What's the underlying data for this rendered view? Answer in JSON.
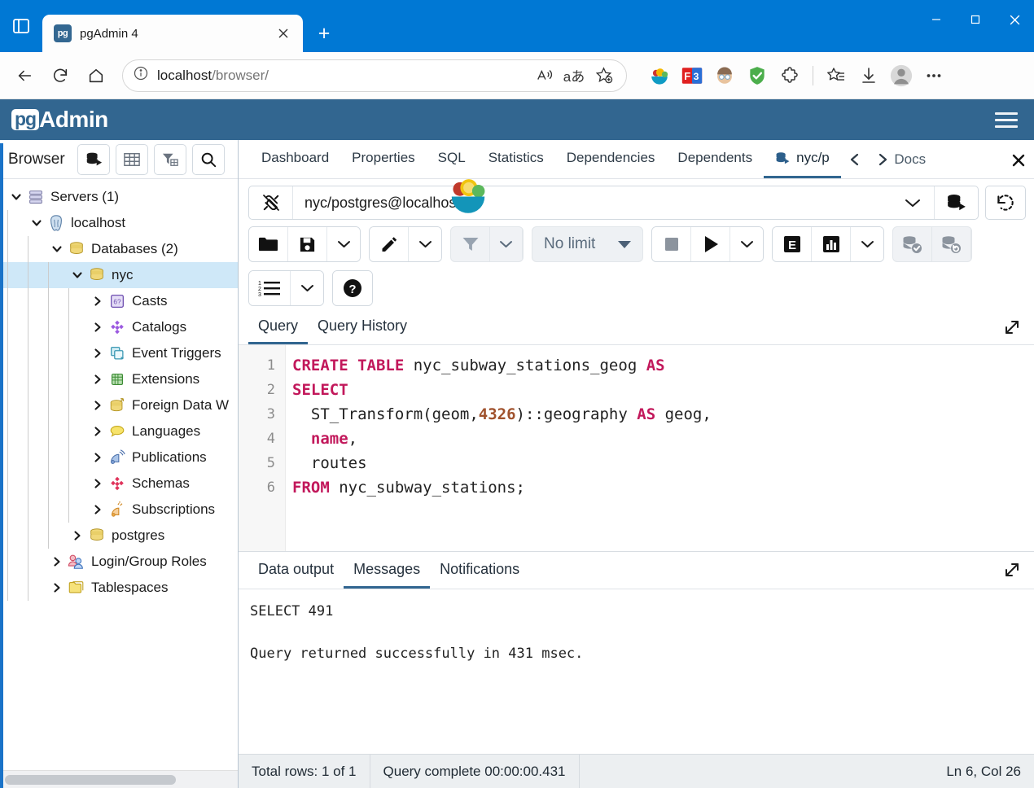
{
  "browser": {
    "tab": {
      "title": "pgAdmin 4",
      "favicon_label": "pg",
      "close_icon": "close-icon"
    },
    "new_tab_label": "+",
    "window_controls": {
      "minimize": "minimize-icon",
      "maximize": "maximize-icon",
      "close": "close-icon"
    },
    "nav": {
      "back": "back-arrow-icon",
      "refresh": "reload-icon",
      "home": "home-icon"
    },
    "url": {
      "scheme_icon": "info-icon",
      "host": "localhost",
      "path": "/browser/"
    },
    "url_icons": [
      "read-aloud-icon",
      "translate-icon",
      "add-favorite-icon"
    ],
    "ext_icons": [
      "fruit-bowl-extension-icon",
      "f3-extension-icon",
      "avatar-extension-icon",
      "adblock-shield-icon",
      "extensions-puzzle-icon",
      "collections-icon",
      "downloads-icon",
      "profile-icon",
      "settings-more-icon"
    ]
  },
  "pgadmin": {
    "brand_mark": "pg",
    "brand_text": "Admin",
    "menu_icon": "hamburger-menu-icon",
    "accent_color": "#326690",
    "browser_panel": {
      "title": "Browser",
      "buttons": [
        "query-tool-icon",
        "view-data-icon",
        "filter-data-icon",
        "search-icon"
      ],
      "tree": [
        {
          "label": "Servers (1)",
          "depth": 0,
          "expanded": true,
          "icon": "servers-icon",
          "selected": false
        },
        {
          "label": "localhost",
          "depth": 1,
          "expanded": true,
          "icon": "postgres-server-icon",
          "selected": false
        },
        {
          "label": "Databases (2)",
          "depth": 2,
          "expanded": true,
          "icon": "databases-icon",
          "selected": false
        },
        {
          "label": "nyc",
          "depth": 3,
          "expanded": true,
          "icon": "database-icon",
          "selected": true
        },
        {
          "label": "Casts",
          "depth": 4,
          "expanded": false,
          "icon": "casts-icon",
          "selected": false
        },
        {
          "label": "Catalogs",
          "depth": 4,
          "expanded": false,
          "icon": "catalogs-icon",
          "selected": false
        },
        {
          "label": "Event Triggers",
          "depth": 4,
          "expanded": false,
          "icon": "event-triggers-icon",
          "selected": false
        },
        {
          "label": "Extensions",
          "depth": 4,
          "expanded": false,
          "icon": "extensions-icon",
          "selected": false
        },
        {
          "label": "Foreign Data W",
          "depth": 4,
          "expanded": false,
          "icon": "foreign-data-wrappers-icon",
          "selected": false
        },
        {
          "label": "Languages",
          "depth": 4,
          "expanded": false,
          "icon": "languages-icon",
          "selected": false
        },
        {
          "label": "Publications",
          "depth": 4,
          "expanded": false,
          "icon": "publications-icon",
          "selected": false
        },
        {
          "label": "Schemas",
          "depth": 4,
          "expanded": false,
          "icon": "schemas-icon",
          "selected": false
        },
        {
          "label": "Subscriptions",
          "depth": 4,
          "expanded": false,
          "icon": "subscriptions-icon",
          "selected": false
        },
        {
          "label": "postgres",
          "depth": 3,
          "expanded": false,
          "icon": "database-icon",
          "selected": false
        },
        {
          "label": "Login/Group Roles",
          "depth": 2,
          "expanded": false,
          "icon": "login-group-roles-icon",
          "selected": false
        },
        {
          "label": "Tablespaces",
          "depth": 2,
          "expanded": false,
          "icon": "tablespaces-icon",
          "selected": false
        }
      ]
    },
    "object_tabs": [
      {
        "label": "Dashboard",
        "active": false
      },
      {
        "label": "Properties",
        "active": false
      },
      {
        "label": "SQL",
        "active": false
      },
      {
        "label": "Statistics",
        "active": false
      },
      {
        "label": "Dependencies",
        "active": false
      },
      {
        "label": "Dependents",
        "active": false
      },
      {
        "label": "nyc/p",
        "active": true,
        "icon": "query-tool-icon"
      }
    ],
    "tab_nav": {
      "prev": "chevron-left-icon",
      "next": "chevron-right-icon",
      "close": "close-tab-icon",
      "obscured_text": "Docs"
    },
    "connection": {
      "plug_icon": "disconnected-plug-icon",
      "value": "nyc/postgres@localhost",
      "caret_icon": "chevron-down-icon",
      "db_icon": "query-tool-icon",
      "refresh_icon": "reset-layout-icon",
      "overlay_icon": "fruit-bowl-cursor-icon"
    },
    "query_toolbar": {
      "open_file": "open-file-icon",
      "save_file": "save-file-icon",
      "save_caret": "chevron-down-icon",
      "edit": "edit-pencil-icon",
      "edit_caret": "chevron-down-icon",
      "filter": "filter-icon",
      "filter_caret": "chevron-down-icon",
      "row_limit_label": "No limit",
      "row_limit_caret": "caret-down-icon",
      "stop": "stop-query-icon",
      "execute": "execute-play-icon",
      "execute_caret": "chevron-down-icon",
      "explain": "explain-e-icon",
      "explain_analyze": "explain-analyze-chart-icon",
      "explain_caret": "chevron-down-icon",
      "commit": "commit-icon",
      "rollback": "rollback-icon",
      "macros": "macros-list-icon",
      "macros_caret": "chevron-down-icon",
      "help": "help-question-icon"
    },
    "query_tabs": [
      {
        "label": "Query",
        "active": true
      },
      {
        "label": "Query History",
        "active": false
      }
    ],
    "query_expand_icon": "expand-panel-icon",
    "editor": {
      "line_numbers": [
        "1",
        "2",
        "3",
        "4",
        "5",
        "6"
      ],
      "lines": [
        [
          {
            "t": "CREATE TABLE ",
            "c": "kw"
          },
          {
            "t": "nyc_subway_stations_geog ",
            "c": ""
          },
          {
            "t": "AS",
            "c": "kw"
          }
        ],
        [
          {
            "t": "SELECT",
            "c": "kw"
          }
        ],
        [
          {
            "t": "  ST_Transform(geom,",
            "c": ""
          },
          {
            "t": "4326",
            "c": "num"
          },
          {
            "t": ")::geography ",
            "c": ""
          },
          {
            "t": "AS",
            "c": "kw"
          },
          {
            "t": " geog,",
            "c": ""
          }
        ],
        [
          {
            "t": "  ",
            "c": ""
          },
          {
            "t": "name",
            "c": "kw"
          },
          {
            "t": ",",
            "c": ""
          }
        ],
        [
          {
            "t": "  routes",
            "c": ""
          }
        ],
        [
          {
            "t": "FROM",
            "c": "kw"
          },
          {
            "t": " nyc_subway_stations;",
            "c": ""
          }
        ]
      ]
    },
    "output_tabs": [
      {
        "label": "Data output",
        "active": false
      },
      {
        "label": "Messages",
        "active": true
      },
      {
        "label": "Notifications",
        "active": false
      }
    ],
    "output_expand_icon": "expand-panel-icon",
    "messages": [
      "SELECT 491",
      "",
      "Query returned successfully in 431 msec."
    ],
    "status_bar": {
      "total_rows": "Total rows: 1 of 1",
      "query_complete": "Query complete 00:00:00.431",
      "cursor_position": "Ln 6, Col 26"
    }
  }
}
